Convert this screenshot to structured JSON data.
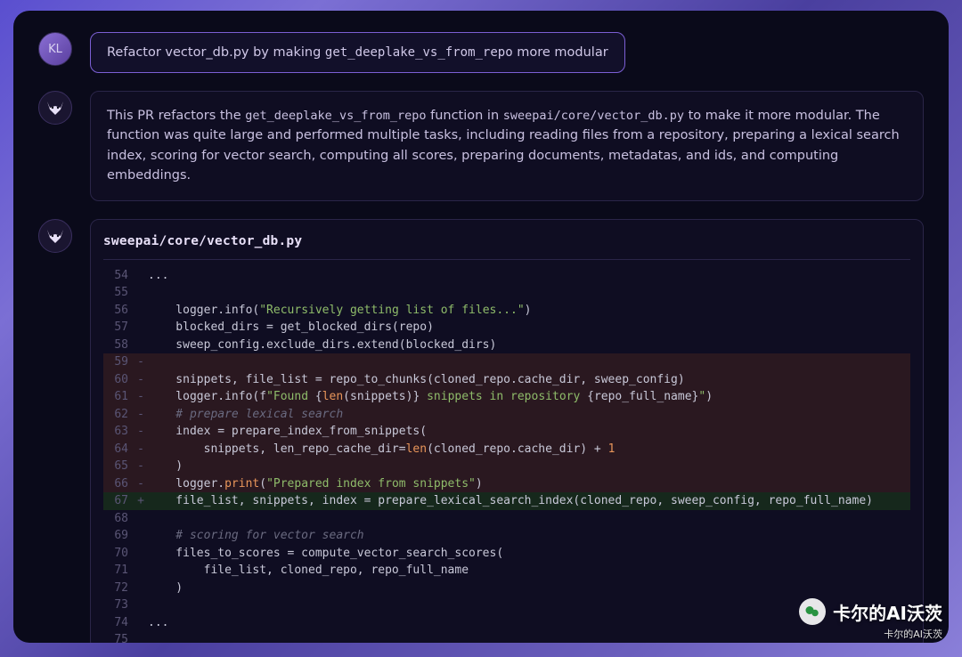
{
  "user": {
    "initials": "KL"
  },
  "prompt": {
    "pre": "Refactor vector_db.py by making ",
    "code": "get_deeplake_vs_from_repo",
    "post": " more modular"
  },
  "reply": {
    "p1a": "This PR refactors the ",
    "p1code1": "get_deeplake_vs_from_repo",
    "p1b": " function in ",
    "p1code2": "sweepai/core/vector_db.py",
    "p1c": " to make it more modular. The function was quite large and performed multiple tasks, including reading files from a repository, preparing a lexical search index, scoring for vector search, computing all scores, preparing documents, metadatas, and ids, and computing embeddings."
  },
  "diff": {
    "file": "sweepai/core/vector_db.py",
    "lines": [
      {
        "n": "54",
        "m": "",
        "kind": "",
        "segs": [
          {
            "t": "...",
            "c": ""
          }
        ]
      },
      {
        "n": "55",
        "m": "",
        "kind": "",
        "segs": [
          {
            "t": "",
            "c": ""
          }
        ]
      },
      {
        "n": "56",
        "m": "",
        "kind": "",
        "segs": [
          {
            "t": "    logger.info(",
            "c": ""
          },
          {
            "t": "\"Recursively getting list of files...\"",
            "c": "tok-str"
          },
          {
            "t": ")",
            "c": ""
          }
        ]
      },
      {
        "n": "57",
        "m": "",
        "kind": "",
        "segs": [
          {
            "t": "    blocked_dirs = get_blocked_dirs(repo)",
            "c": ""
          }
        ]
      },
      {
        "n": "58",
        "m": "",
        "kind": "",
        "segs": [
          {
            "t": "    sweep_config.exclude_dirs.extend(blocked_dirs)",
            "c": ""
          }
        ]
      },
      {
        "n": "59",
        "m": "-",
        "kind": "removed",
        "segs": [
          {
            "t": "",
            "c": ""
          }
        ]
      },
      {
        "n": "60",
        "m": "-",
        "kind": "removed",
        "segs": [
          {
            "t": "    snippets, file_list = repo_to_chunks(cloned_repo.cache_dir, sweep_config)",
            "c": ""
          }
        ]
      },
      {
        "n": "61",
        "m": "-",
        "kind": "removed",
        "segs": [
          {
            "t": "    logger.info(f",
            "c": ""
          },
          {
            "t": "\"Found ",
            "c": "tok-str"
          },
          {
            "t": "{",
            "c": ""
          },
          {
            "t": "len",
            "c": "tok-fn"
          },
          {
            "t": "(snippets)",
            "c": ""
          },
          {
            "t": "}",
            "c": ""
          },
          {
            "t": " snippets in repository ",
            "c": "tok-str"
          },
          {
            "t": "{repo_full_name}",
            "c": ""
          },
          {
            "t": "\"",
            "c": "tok-str"
          },
          {
            "t": ")",
            "c": ""
          }
        ]
      },
      {
        "n": "62",
        "m": "-",
        "kind": "removed",
        "segs": [
          {
            "t": "    # prepare lexical search",
            "c": "tok-com"
          }
        ]
      },
      {
        "n": "63",
        "m": "-",
        "kind": "removed",
        "segs": [
          {
            "t": "    index = prepare_index_from_snippets(",
            "c": ""
          }
        ]
      },
      {
        "n": "64",
        "m": "-",
        "kind": "removed",
        "segs": [
          {
            "t": "        snippets, len_repo_cache_dir=",
            "c": ""
          },
          {
            "t": "len",
            "c": "tok-fn"
          },
          {
            "t": "(cloned_repo.cache_dir) + ",
            "c": ""
          },
          {
            "t": "1",
            "c": "tok-num"
          }
        ]
      },
      {
        "n": "65",
        "m": "-",
        "kind": "removed",
        "segs": [
          {
            "t": "    )",
            "c": ""
          }
        ]
      },
      {
        "n": "66",
        "m": "-",
        "kind": "removed",
        "segs": [
          {
            "t": "    logger.",
            "c": ""
          },
          {
            "t": "print",
            "c": "tok-fn"
          },
          {
            "t": "(",
            "c": ""
          },
          {
            "t": "\"Prepared index from snippets\"",
            "c": "tok-str"
          },
          {
            "t": ")",
            "c": ""
          }
        ]
      },
      {
        "n": "67",
        "m": "+",
        "kind": "added",
        "segs": [
          {
            "t": "    file_list, snippets, index = prepare_lexical_search_index(cloned_repo, sweep_config, repo_full_name)",
            "c": ""
          }
        ]
      },
      {
        "n": "68",
        "m": "",
        "kind": "",
        "segs": [
          {
            "t": "",
            "c": ""
          }
        ]
      },
      {
        "n": "69",
        "m": "",
        "kind": "",
        "segs": [
          {
            "t": "    # scoring for vector search",
            "c": "tok-com"
          }
        ]
      },
      {
        "n": "70",
        "m": "",
        "kind": "",
        "segs": [
          {
            "t": "    files_to_scores = compute_vector_search_scores(",
            "c": ""
          }
        ]
      },
      {
        "n": "71",
        "m": "",
        "kind": "",
        "segs": [
          {
            "t": "        file_list, cloned_repo, repo_full_name",
            "c": ""
          }
        ]
      },
      {
        "n": "72",
        "m": "",
        "kind": "",
        "segs": [
          {
            "t": "    )",
            "c": ""
          }
        ]
      },
      {
        "n": "73",
        "m": "",
        "kind": "",
        "segs": [
          {
            "t": "",
            "c": ""
          }
        ]
      },
      {
        "n": "74",
        "m": "",
        "kind": "",
        "segs": [
          {
            "t": "...",
            "c": ""
          }
        ]
      },
      {
        "n": "75",
        "m": "",
        "kind": "",
        "segs": [
          {
            "t": "",
            "c": ""
          }
        ]
      }
    ]
  },
  "watermark": {
    "main": "卡尔的AI沃茨",
    "sub": "卡尔的AI沃茨"
  }
}
